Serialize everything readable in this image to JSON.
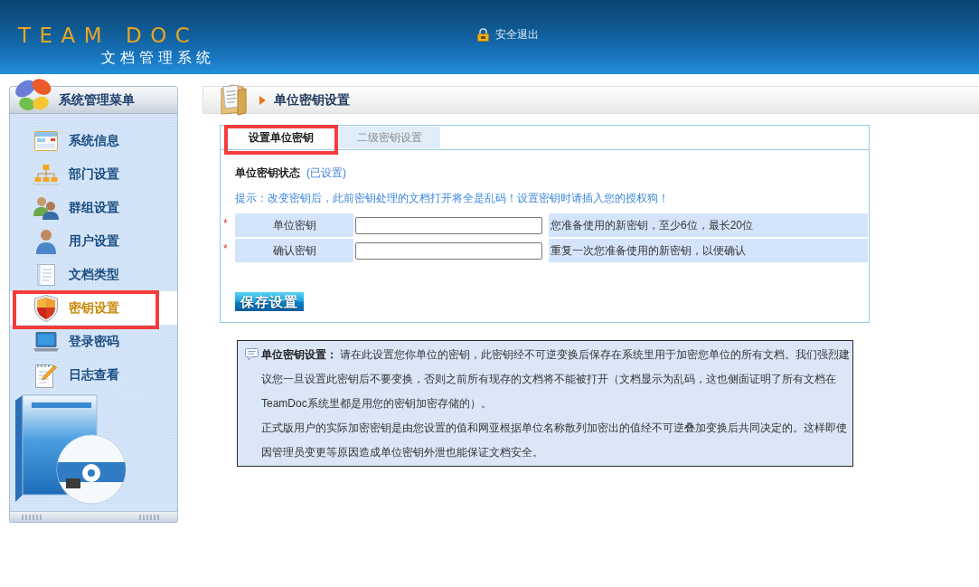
{
  "header": {
    "logo_title": "TEAM DOC",
    "logo_subtitle": "文档管理系统",
    "logout_label": "安全退出"
  },
  "sidebar": {
    "title": "系统管理菜单",
    "items": [
      {
        "label": "系统信息",
        "selected": false,
        "highlighted": false
      },
      {
        "label": "部门设置",
        "selected": false,
        "highlighted": false
      },
      {
        "label": "群组设置",
        "selected": false,
        "highlighted": false
      },
      {
        "label": "用户设置",
        "selected": false,
        "highlighted": false
      },
      {
        "label": "文档类型",
        "selected": false,
        "highlighted": false
      },
      {
        "label": "密钥设置",
        "selected": true,
        "highlighted": true
      },
      {
        "label": "登录密码",
        "selected": false,
        "highlighted": false
      },
      {
        "label": "日志查看",
        "selected": false,
        "highlighted": false
      }
    ]
  },
  "page_title": "单位密钥设置",
  "tabs": [
    {
      "label": "设置单位密钥",
      "selected": true,
      "highlighted": true
    },
    {
      "label": "二级密钥设置",
      "selected": false,
      "highlighted": false
    }
  ],
  "key_status": {
    "label": "单位密钥状态",
    "value": "(已设置)"
  },
  "hint": "提示：改变密钥后，此前密钥处理的文档打开将全是乱码！设置密钥时请插入您的授权狗！",
  "fields": [
    {
      "required_mark": "*",
      "label": "单位密钥",
      "help": "您准备使用的新密钥，至少6位，最长20位"
    },
    {
      "required_mark": "*",
      "label": "确认密钥",
      "help": "重复一次您准备使用的新密钥，以便确认"
    }
  ],
  "save_button": "保存设置",
  "note": {
    "paragraphs": [
      "**单位密钥设置：** 请在此设置您你单位的密钥，此密钥经不可逆变换后保存在系统里用于加密您单位的所有文档。我们强烈建议您一旦设置此密钥后不要变换，否则之前所有现存的文档将不能被打开（文档显示为乱码，这也侧面证明了所有文档在TeamDoc系统里都是用您的密钥加密存储的）。",
      "正式版用户的实际加密密钥是由您设置的值和网亚根据单位名称散列加密出的值经不可逆叠加变换后共同决定的。这样即使因管理员变更等原因造成单位密钥外泄也能保证文档安全。"
    ]
  }
}
